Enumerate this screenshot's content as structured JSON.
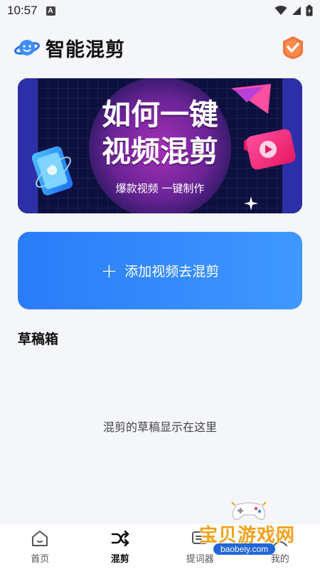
{
  "status_bar": {
    "time": "10:57",
    "notification_letter": "A"
  },
  "header": {
    "title": "智能混剪",
    "logo_icon": "planet-face-icon",
    "vip_icon": "vip-shield-icon"
  },
  "banner": {
    "title_line1": "如何一键",
    "title_line2": "视频混剪",
    "subtitle": "爆款视频 一键制作"
  },
  "add_button": {
    "label": "添加视频去混剪",
    "icon": "plus-icon",
    "color": "#3489fb"
  },
  "drafts": {
    "title": "草稿箱",
    "empty_text": "混剪的草稿显示在这里"
  },
  "bottom_nav": {
    "items": [
      {
        "label": "首页",
        "icon": "home-icon",
        "active": false
      },
      {
        "label": "混剪",
        "icon": "shuffle-icon",
        "active": true
      },
      {
        "label": "提词器",
        "icon": "teleprompter-icon",
        "active": false
      },
      {
        "label": "我的",
        "icon": "profile-icon",
        "active": false
      }
    ]
  },
  "watermark": {
    "text": "宝贝游戏网",
    "url": "baobeiy.com"
  }
}
